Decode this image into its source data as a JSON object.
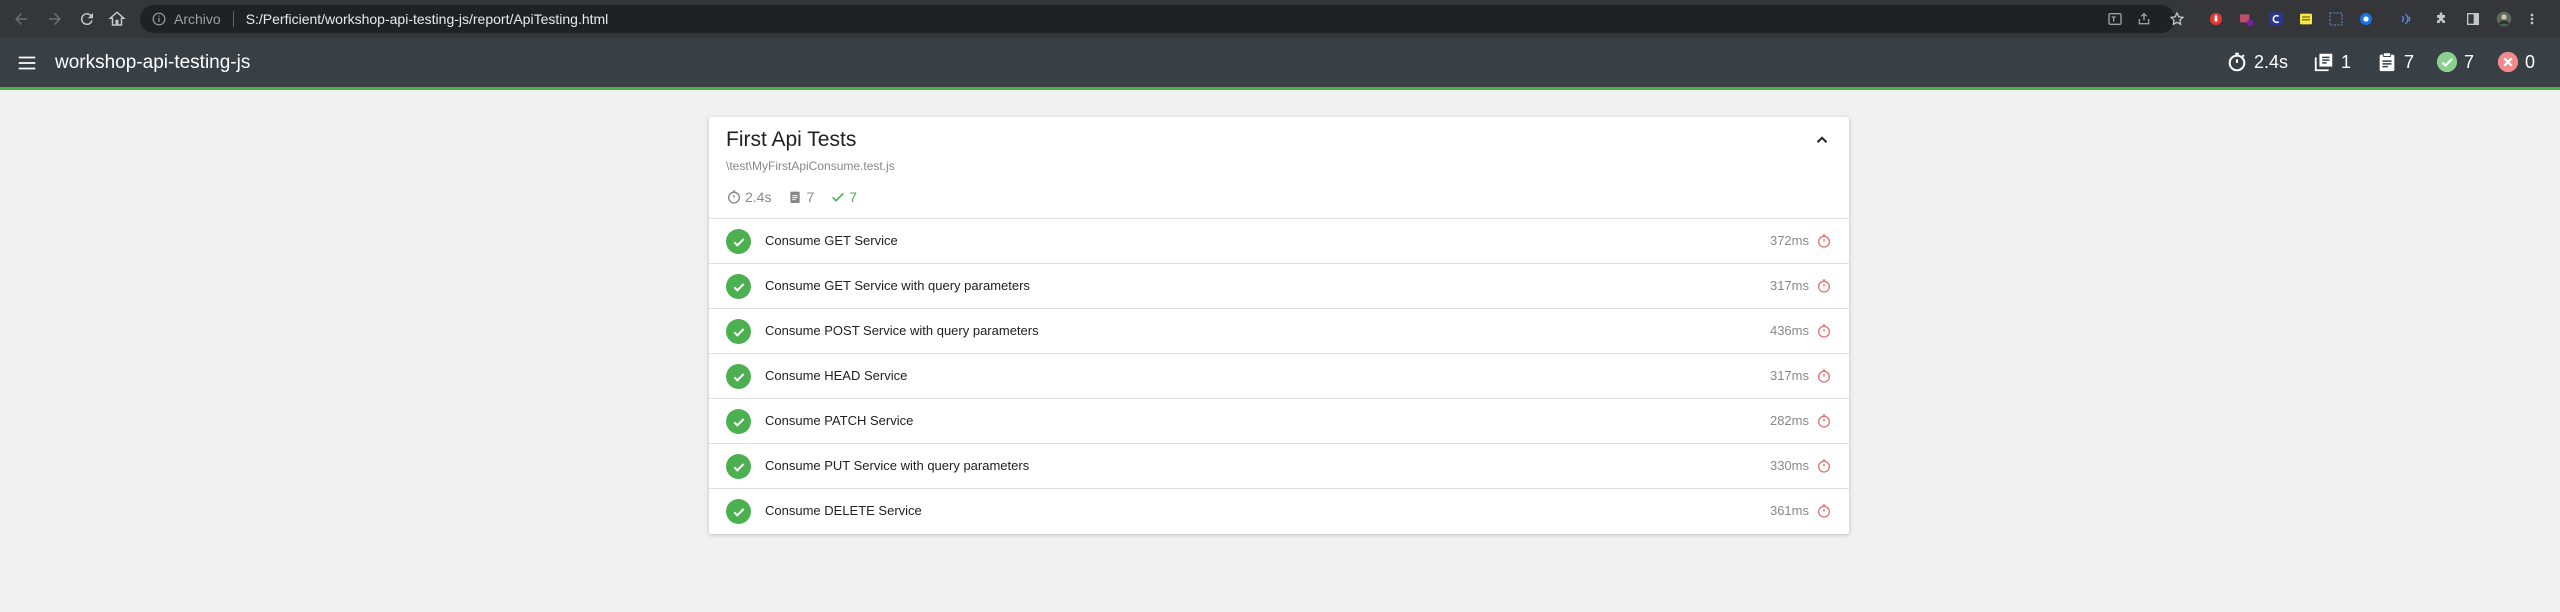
{
  "browser": {
    "security_label": "Archivo",
    "url": "S:/Perficient/workshop-api-testing-js/report/ApiTesting.html"
  },
  "header": {
    "title": "workshop-api-testing-js",
    "duration": "2.4s",
    "suites": "1",
    "tests": "7",
    "passed": "7",
    "failed": "0"
  },
  "suite": {
    "title": "First Api Tests",
    "file": "\\test\\MyFirstApiConsume.test.js",
    "duration": "2.4s",
    "tests": "7",
    "passed": "7"
  },
  "test_list": [
    {
      "name": "Consume GET Service",
      "duration": "372ms"
    },
    {
      "name": "Consume GET Service with query parameters",
      "duration": "317ms"
    },
    {
      "name": "Consume POST Service with query parameters",
      "duration": "436ms"
    },
    {
      "name": "Consume HEAD Service",
      "duration": "317ms"
    },
    {
      "name": "Consume PATCH Service",
      "duration": "282ms"
    },
    {
      "name": "Consume PUT Service with query parameters",
      "duration": "330ms"
    },
    {
      "name": "Consume DELETE Service",
      "duration": "361ms"
    }
  ],
  "colors": {
    "pass": "#4caf50",
    "fail": "#f44336",
    "slow": "#e57373",
    "header_bg": "#383f45"
  }
}
